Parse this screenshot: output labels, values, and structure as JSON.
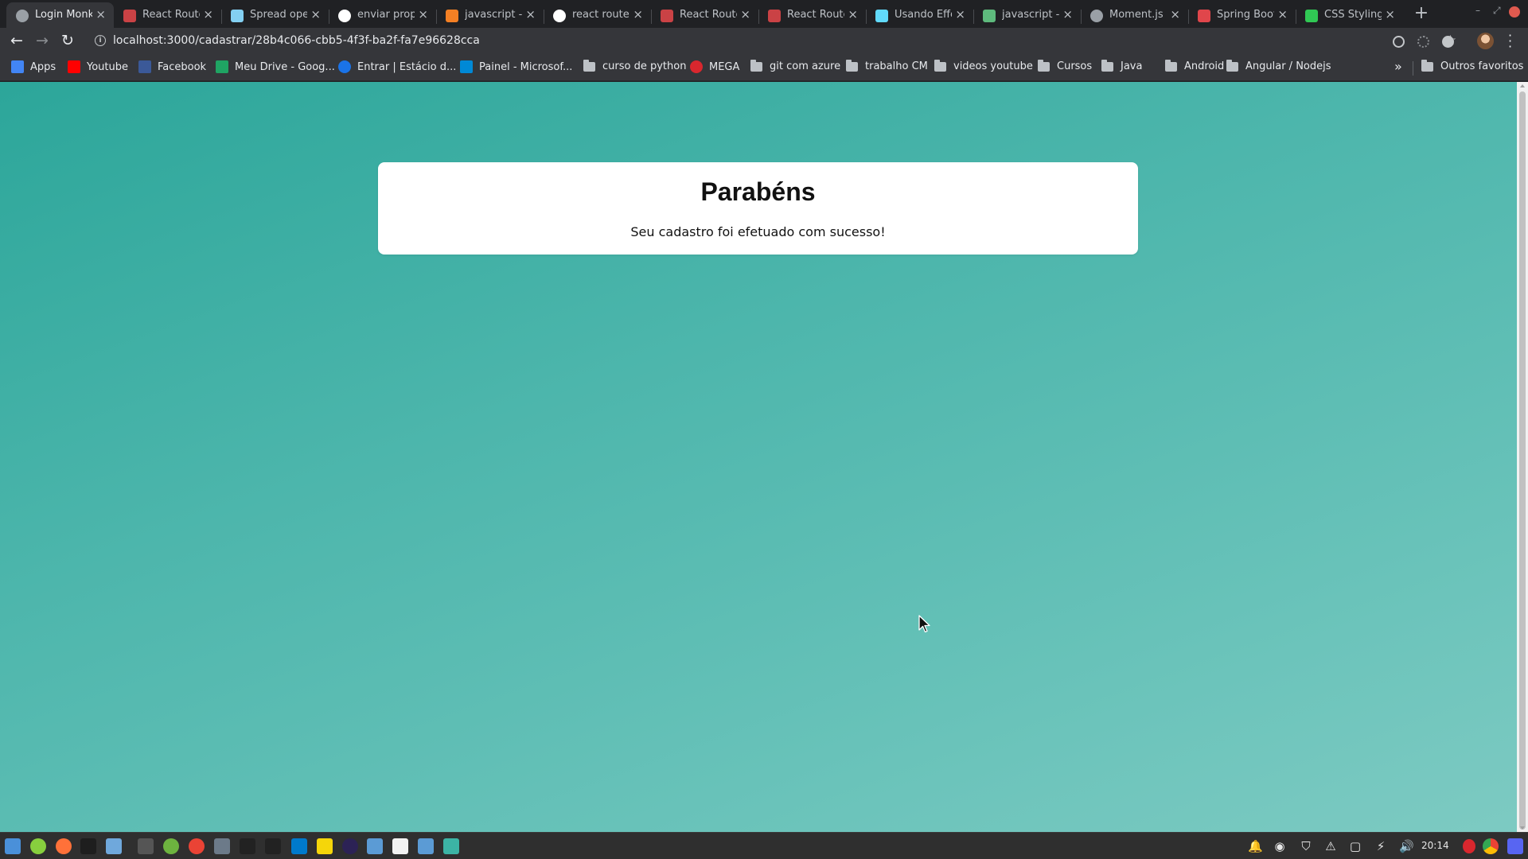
{
  "browser": {
    "tabs": [
      {
        "title": "Login Monk",
        "favicon": "globe-icon",
        "color": "#9aa0a6",
        "active": true
      },
      {
        "title": "React Route",
        "favicon": "react-router-icon",
        "color": "#ca4245"
      },
      {
        "title": "Spread ope",
        "favicon": "mdn-icon",
        "color": "#83d0f2"
      },
      {
        "title": "enviar prop",
        "favicon": "google-icon",
        "color": "#ffffff"
      },
      {
        "title": "javascript -",
        "favicon": "stackoverflow-icon",
        "color": "#f48024"
      },
      {
        "title": "react router",
        "favicon": "google-icon",
        "color": "#ffffff"
      },
      {
        "title": "React Route",
        "favicon": "react-router-icon",
        "color": "#ca4245"
      },
      {
        "title": "React Route",
        "favicon": "react-router-icon",
        "color": "#ca4245"
      },
      {
        "title": "Usando Effe",
        "favicon": "react-icon",
        "color": "#61dafb"
      },
      {
        "title": "javascript -",
        "favicon": "stackoverflow-icon",
        "color": "#5eba7d"
      },
      {
        "title": "Moment.js |",
        "favicon": "clock-icon",
        "color": "#9aa0a6"
      },
      {
        "title": "Spring Boot",
        "favicon": "spring-icon",
        "color": "#e0464b"
      },
      {
        "title": "CSS Styling",
        "favicon": "styled-icon",
        "color": "#30c854"
      }
    ],
    "url": "localhost:3000/cadastrar/28b4c066-cbb5-4f3f-ba2f-fa7e96628cca",
    "bookmarks": [
      {
        "label": "Apps",
        "icon": "apps-grid-icon",
        "color": "#4285f4"
      },
      {
        "label": "Youtube",
        "icon": "youtube-icon",
        "color": "#ff0000"
      },
      {
        "label": "Facebook",
        "icon": "facebook-icon",
        "color": "#3b5998"
      },
      {
        "label": "Meu Drive - Goog...",
        "icon": "drive-icon",
        "color": "#1fa463"
      },
      {
        "label": "Entrar | Estácio d...",
        "icon": "estacio-icon",
        "color": "#1a73e8"
      },
      {
        "label": "Painel - Microsof...",
        "icon": "azure-icon",
        "color": "#0089d6"
      },
      {
        "label": "curso de python",
        "icon": "folder-icon",
        "color": "#bdc1c6"
      },
      {
        "label": "MEGA",
        "icon": "mega-icon",
        "color": "#d9272e"
      },
      {
        "label": "git com azure",
        "icon": "folder-icon",
        "color": "#bdc1c6"
      },
      {
        "label": "trabalho CM",
        "icon": "folder-icon",
        "color": "#bdc1c6"
      },
      {
        "label": "videos youtube",
        "icon": "folder-icon",
        "color": "#bdc1c6"
      },
      {
        "label": "Cursos",
        "icon": "folder-icon",
        "color": "#bdc1c6"
      },
      {
        "label": "Java",
        "icon": "folder-icon",
        "color": "#bdc1c6"
      },
      {
        "label": "Android",
        "icon": "folder-icon",
        "color": "#bdc1c6"
      },
      {
        "label": "Angular / Nodejs",
        "icon": "folder-icon",
        "color": "#bdc1c6"
      }
    ],
    "other_bookmarks": "Outros favoritos"
  },
  "page": {
    "heading": "Parabéns",
    "message": "Seu cadastro foi efetuado com sucesso!",
    "background_start": "#2ca69a",
    "background_end": "#7dcac2"
  },
  "taskbar": {
    "clock": "20:14",
    "apps": [
      {
        "name": "show-desktop-icon",
        "color": "#4a90d9"
      },
      {
        "name": "mint-menu-icon",
        "color": "#87cf3e"
      },
      {
        "name": "firefox-icon",
        "color": "#ff7139"
      },
      {
        "name": "terminal-icon",
        "color": "#1e1e1e"
      },
      {
        "name": "files-icon",
        "color": "#6fa8dc"
      },
      {
        "name": "keyboard-icon",
        "color": "#555555"
      },
      {
        "name": "spring-tool-icon",
        "color": "#6db33f"
      },
      {
        "name": "chrome-icon",
        "color": "#ea4335"
      },
      {
        "name": "folder-app-icon",
        "color": "#6c7a89"
      },
      {
        "name": "terminal-2-icon",
        "color": "#222222"
      },
      {
        "name": "terminal-3-icon",
        "color": "#222222"
      },
      {
        "name": "vscode-icon",
        "color": "#007acc"
      },
      {
        "name": "notes-icon",
        "color": "#f5d60a"
      },
      {
        "name": "eclipse-icon",
        "color": "#2c2255"
      },
      {
        "name": "filemanager-icon",
        "color": "#5b9bd5"
      },
      {
        "name": "document-icon",
        "color": "#f2f2f2"
      },
      {
        "name": "screenshot-icon",
        "color": "#5b9bd5"
      },
      {
        "name": "network-icon",
        "color": "#3cb4a5"
      }
    ],
    "tray": [
      {
        "name": "bell-icon",
        "glyph": "🔔"
      },
      {
        "name": "discord-tray-icon",
        "glyph": "◉"
      },
      {
        "name": "shield-icon",
        "glyph": "⛉"
      },
      {
        "name": "warning-icon",
        "glyph": "⚠"
      },
      {
        "name": "window-icon",
        "glyph": "▢"
      },
      {
        "name": "power-icon",
        "glyph": "⚡"
      },
      {
        "name": "volume-icon",
        "glyph": "🔊"
      }
    ]
  }
}
